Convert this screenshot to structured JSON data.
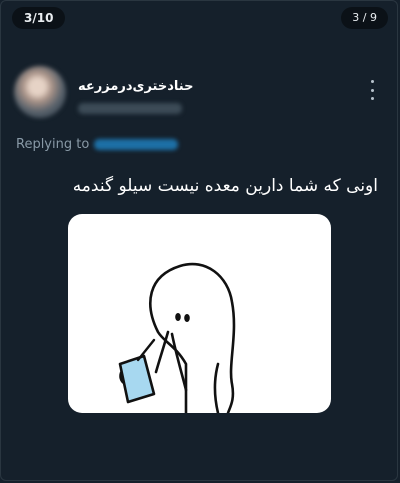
{
  "top_bar": {
    "left_counter": "3/10",
    "right_counter": "3 / 9"
  },
  "tweet": {
    "display_name": "حنا‌دختری‌درمزرعه",
    "reply_label": "Replying to",
    "text": "اونی که شما دارین معده نیست سیلو گندمه"
  },
  "icons": {
    "more": "vertical-ellipsis-icon"
  },
  "colors": {
    "background": "#15202b",
    "secondary_text": "#8899a6",
    "mention": "#1d9bf0",
    "cup": "#a7d8f0"
  }
}
